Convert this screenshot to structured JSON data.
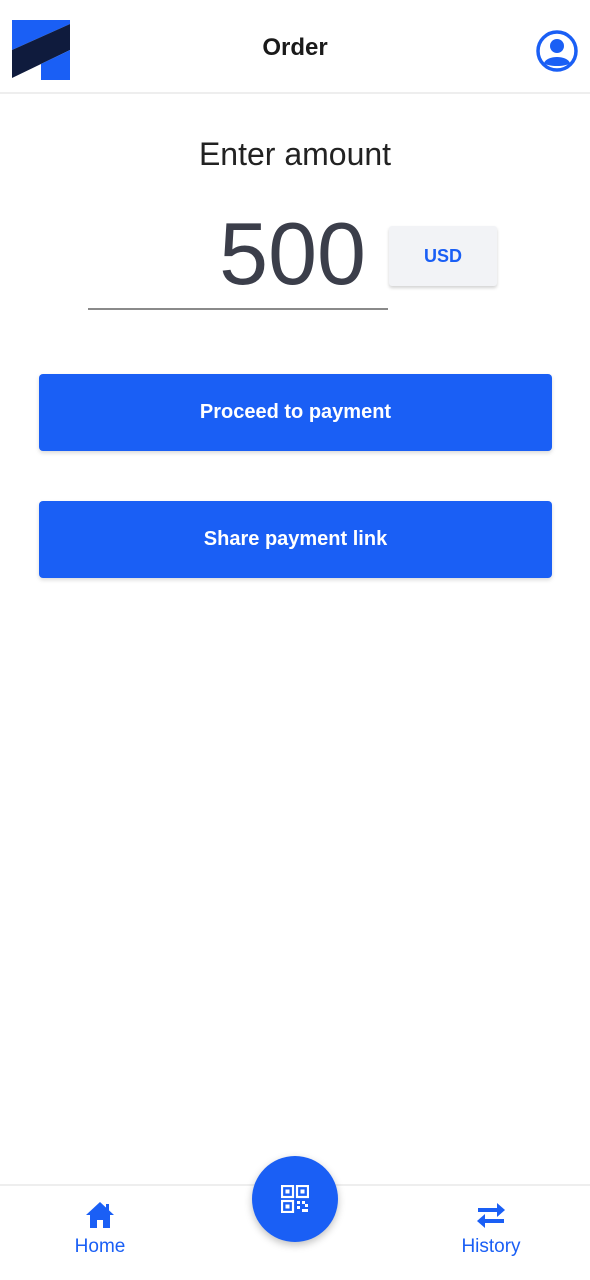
{
  "header": {
    "title": "Order",
    "logo_icon": "brand-logo-icon",
    "profile_icon": "user-circle-icon"
  },
  "amount": {
    "label": "Enter amount",
    "value": "500",
    "currency": "USD"
  },
  "actions": {
    "proceed_label": "Proceed to payment",
    "share_label": "Share payment link"
  },
  "bottom_nav": {
    "home_label": "Home",
    "home_icon": "home-icon",
    "scan_icon": "qr-code-icon",
    "history_label": "History",
    "history_icon": "swap-arrows-icon"
  },
  "colors": {
    "accent": "#1a5ff5",
    "logo_dark": "#0f1b3d",
    "text": "#1a1a1a"
  }
}
